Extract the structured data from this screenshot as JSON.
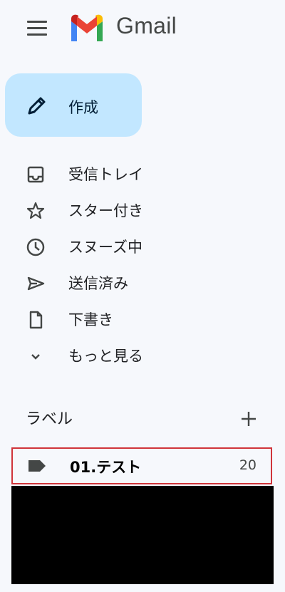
{
  "app": {
    "brand": "Gmail"
  },
  "compose": {
    "label": "作成"
  },
  "nav": [
    {
      "label": "受信トレイ",
      "icon": "inbox-icon"
    },
    {
      "label": "スター付き",
      "icon": "star-icon"
    },
    {
      "label": "スヌーズ中",
      "icon": "clock-icon"
    },
    {
      "label": "送信済み",
      "icon": "send-icon"
    },
    {
      "label": "下書き",
      "icon": "draft-icon"
    },
    {
      "label": "もっと見る",
      "icon": "chevron-down-icon"
    }
  ],
  "labels": {
    "heading": "ラベル",
    "items": [
      {
        "name": "01.テスト",
        "count": "20"
      }
    ]
  },
  "colors": {
    "compose_bg": "#c2e7ff",
    "highlight_border": "#d0343a",
    "background": "#f6f8fc"
  }
}
